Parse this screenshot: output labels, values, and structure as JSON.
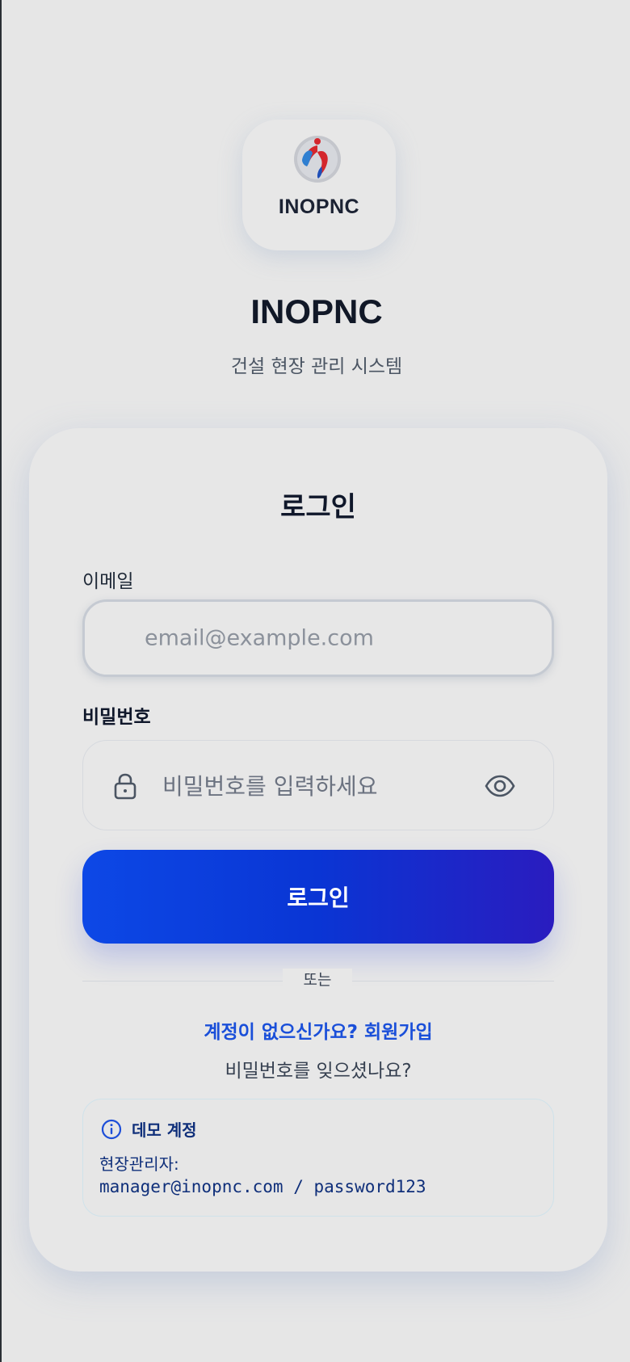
{
  "brand": {
    "logo_text": "INOPNC",
    "title": "INOPNC",
    "subtitle": "건설 현장 관리 시스템"
  },
  "login_card": {
    "title": "로그인",
    "email": {
      "label": "이메일",
      "placeholder": "email@example.com",
      "value": ""
    },
    "password": {
      "label": "비밀번호",
      "placeholder": "비밀번호를 입력하세요",
      "value": ""
    },
    "submit_label": "로그인",
    "divider_text": "또는",
    "signup_link": "계정이 없으신가요? 회원가입",
    "forgot_link": "비밀번호를 잊으셨나요?"
  },
  "demo": {
    "title": "데모 계정",
    "role": "현장관리자:",
    "credentials": "manager@inopnc.com / password123"
  },
  "colors": {
    "background": "#e6e6e6",
    "primary": "#0a35d4",
    "link": "#1a4fd9",
    "demo_text": "#0f2f7a"
  },
  "icons": {
    "password_field_leading": "lock-icon",
    "password_field_trailing": "eye-icon",
    "demo": "info-icon"
  }
}
